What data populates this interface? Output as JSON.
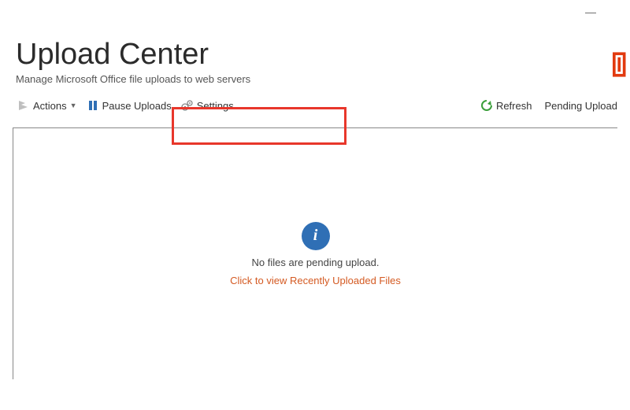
{
  "window": {
    "minimize": "—"
  },
  "header": {
    "title": "Upload Center",
    "subtitle": "Manage Microsoft Office file uploads to web servers"
  },
  "toolbar": {
    "actions_label": "Actions",
    "pause_label": "Pause Uploads",
    "settings_label": "Settings",
    "refresh_label": "Refresh",
    "pending_label": "Pending Upload"
  },
  "content": {
    "info_glyph": "i",
    "empty_message": "No files are pending upload.",
    "recent_link": "Click to view Recently Uploaded Files"
  },
  "annotation": {
    "highlight_color": "#e8372b"
  }
}
